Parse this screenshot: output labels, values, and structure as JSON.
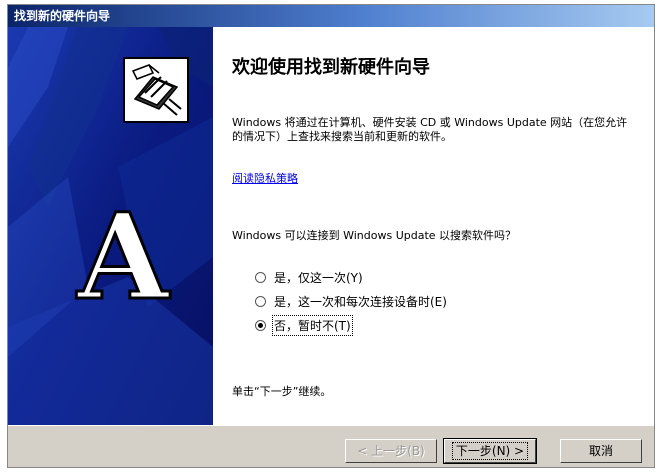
{
  "window": {
    "title": "找到新的硬件向导"
  },
  "left": {
    "icon": "hardware-wizard-icon",
    "letter": "A"
  },
  "main": {
    "heading": "欢迎使用找到新硬件向导",
    "intro": "Windows 将通过在计算机、硬件安装 CD 或 Windows Update 网站（在您允许的情况下）上查找来搜索当前和更新的软件。",
    "privacy_link": "阅读隐私策略",
    "question": "Windows 可以连接到 Windows Update 以搜索软件吗？",
    "options": [
      {
        "label": "是，仅这一次(Y)",
        "checked": false
      },
      {
        "label": "是，这一次和每次连接设备时(E)",
        "checked": false
      },
      {
        "label": "否，暂时不(T)",
        "checked": true
      }
    ],
    "continue_text": "单击“下一步”继续。"
  },
  "buttons": {
    "back": "< 上一步(B)",
    "next": "下一步(N) >",
    "cancel": "取消"
  },
  "colors": {
    "title_bar": "#0a246a",
    "left_panel": "#0b1f8a",
    "link": "#0000ee"
  }
}
